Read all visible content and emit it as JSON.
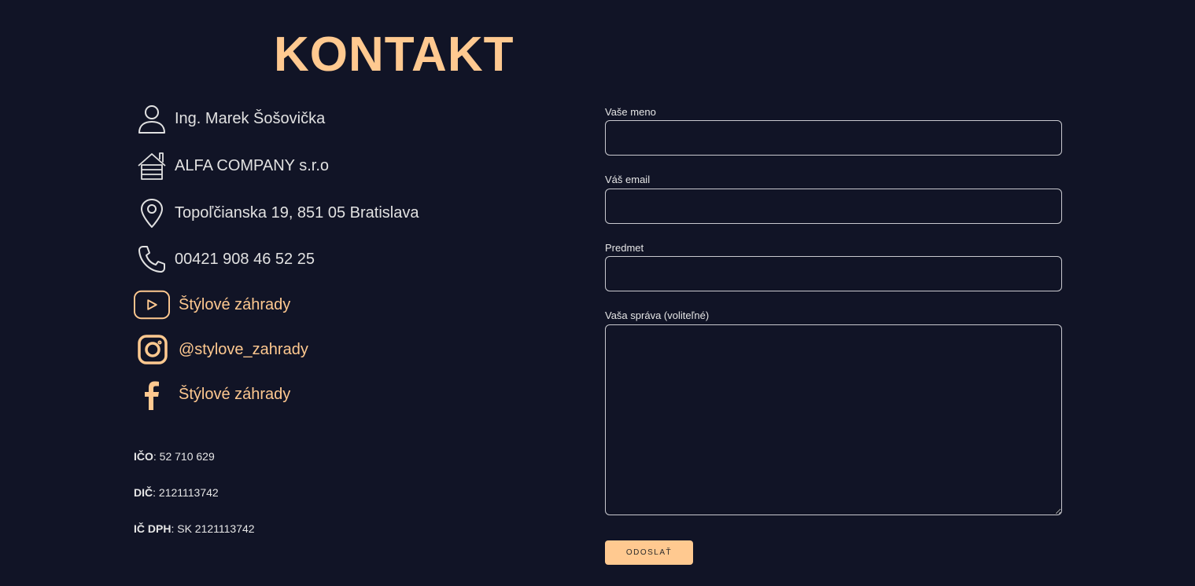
{
  "page": {
    "title": "KONTAKT"
  },
  "contact": {
    "items": [
      {
        "icon": "person-icon",
        "text": "Ing. Marek Šošovička"
      },
      {
        "icon": "house-icon",
        "text": "ALFA COMPANY s.r.o"
      },
      {
        "icon": "location-pin-icon",
        "text": "Topoľčianska 19, 851 05 Bratislava"
      },
      {
        "icon": "phone-icon",
        "text": "00421 908 46 52 25"
      }
    ],
    "social": [
      {
        "icon": "youtube-icon",
        "text": "Štýlové záhrady"
      },
      {
        "icon": "instagram-icon",
        "text": "@stylove_zahrady"
      },
      {
        "icon": "facebook-icon",
        "text": "Štýlové záhrady"
      }
    ]
  },
  "legal": {
    "ico_label": "IČO",
    "ico_value": ": 52 710 629",
    "dic_label": "DIČ",
    "dic_value": ": 2121113742",
    "icdph_label": "IČ DPH",
    "icdph_value": ": SK 2121113742"
  },
  "form": {
    "name_label": "Vaše meno",
    "name_value": "",
    "email_label": "Váš email",
    "email_value": "",
    "subject_label": "Predmet",
    "subject_value": "",
    "message_label": "Vaša správa (voliteľné)",
    "message_value": "",
    "submit_label": "ODOSLAŤ"
  },
  "colors": {
    "background": "#111426",
    "accent": "#ffc990",
    "text": "#e1e1e1"
  }
}
